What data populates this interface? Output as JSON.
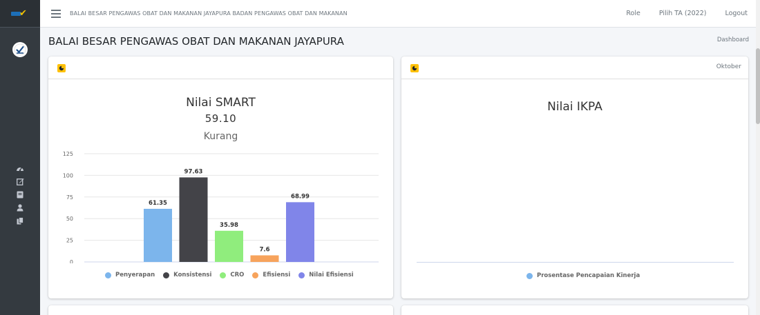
{
  "header": {
    "title": "BALAI BESAR PENGAWAS OBAT DAN MAKANAN JAYAPURA BADAN PENGAWAS OBAT DAN MAKANAN",
    "nav": [
      "Role",
      "Pilih TA (2022)",
      "Logout"
    ]
  },
  "page": {
    "title": "BALAI BESAR PENGAWAS OBAT DAN MAKANAN JAYAPURA",
    "breadcrumb": "Dashboard"
  },
  "sidebar": {
    "icons": [
      "tachometer-icon",
      "edit-icon",
      "book-icon",
      "user-icon",
      "copy-icon"
    ]
  },
  "cards": [
    {
      "title": "Nilai SMART",
      "score": "59.10",
      "rating": "Kurang"
    },
    {
      "tool": "Oktober",
      "title": "Nilai IKPA"
    }
  ],
  "colors": {
    "sidebar": "#343a40",
    "icon_badge": "#ffc107",
    "penyerapan": "#7cb5ec",
    "konsistensi": "#434348",
    "cro": "#90ed7d",
    "efisiensi": "#f7a35c",
    "nilai_efisiensi": "#8085e9"
  },
  "chart_data": [
    {
      "type": "bar",
      "title": "Nilai SMART",
      "categories": [
        "Penyerapan",
        "Konsistensi",
        "CRO",
        "Efisiensi",
        "Nilai Efisiensi"
      ],
      "series": [
        {
          "name": "Penyerapan",
          "values": [
            61.35
          ]
        },
        {
          "name": "Konsistensi",
          "values": [
            97.63
          ]
        },
        {
          "name": "CRO",
          "values": [
            35.98
          ]
        },
        {
          "name": "Efisiensi",
          "values": [
            7.6
          ]
        },
        {
          "name": "Nilai Efisiensi",
          "values": [
            68.99
          ]
        }
      ],
      "values": [
        61.35,
        97.63,
        35.98,
        7.6,
        68.99
      ],
      "data_labels": [
        "61.35",
        "97.63",
        "35.98",
        "7.6",
        "68.99"
      ],
      "yticks": [
        "0",
        "25",
        "50",
        "75",
        "100",
        "125"
      ],
      "ylim": [
        0,
        125
      ],
      "grid": true,
      "legend": "bottom"
    },
    {
      "type": "bar",
      "title": "Nilai IKPA",
      "series": [
        {
          "name": "Prosentase Pencapaian Kinerja",
          "values": []
        }
      ],
      "legend": "bottom"
    }
  ]
}
